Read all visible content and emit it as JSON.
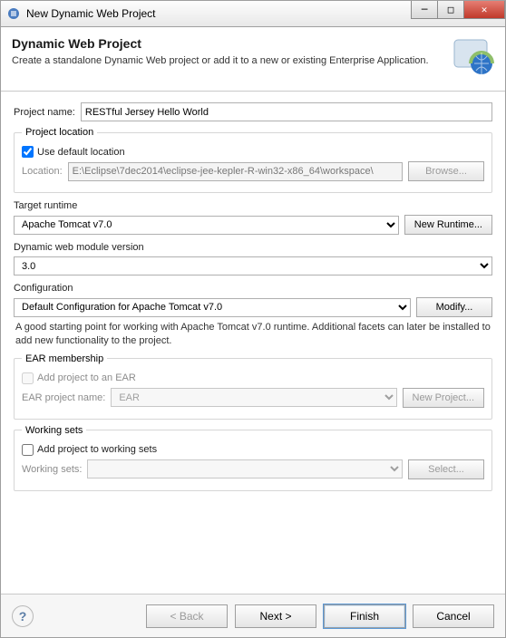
{
  "window": {
    "title": "New Dynamic Web Project"
  },
  "banner": {
    "heading": "Dynamic Web Project",
    "subtext": "Create a standalone Dynamic Web project or add it to a new or existing Enterprise Application."
  },
  "project_name": {
    "label": "Project name:",
    "value": "RESTful Jersey Hello World"
  },
  "project_location": {
    "legend": "Project location",
    "use_default_label": "Use default location",
    "use_default_checked": true,
    "location_label": "Location:",
    "location_value": "E:\\Eclipse\\7dec2014\\eclipse-jee-kepler-R-win32-x86_64\\workspace\\",
    "browse_label": "Browse..."
  },
  "target_runtime": {
    "label": "Target runtime",
    "value": "Apache Tomcat v7.0",
    "new_runtime_label": "New Runtime..."
  },
  "module_version": {
    "label": "Dynamic web module version",
    "value": "3.0"
  },
  "configuration": {
    "label": "Configuration",
    "value": "Default Configuration for Apache Tomcat v7.0",
    "modify_label": "Modify...",
    "help_text": "A good starting point for working with Apache Tomcat v7.0 runtime. Additional facets can later be installed to add new functionality to the project."
  },
  "ear": {
    "legend": "EAR membership",
    "add_label": "Add project to an EAR",
    "add_checked": false,
    "project_name_label": "EAR project name:",
    "project_name_value": "EAR",
    "new_project_label": "New Project..."
  },
  "working_sets": {
    "legend": "Working sets",
    "add_label": "Add project to working sets",
    "add_checked": false,
    "ws_label": "Working sets:",
    "ws_value": "",
    "select_label": "Select..."
  },
  "footer": {
    "back": "< Back",
    "next": "Next >",
    "finish": "Finish",
    "cancel": "Cancel"
  }
}
